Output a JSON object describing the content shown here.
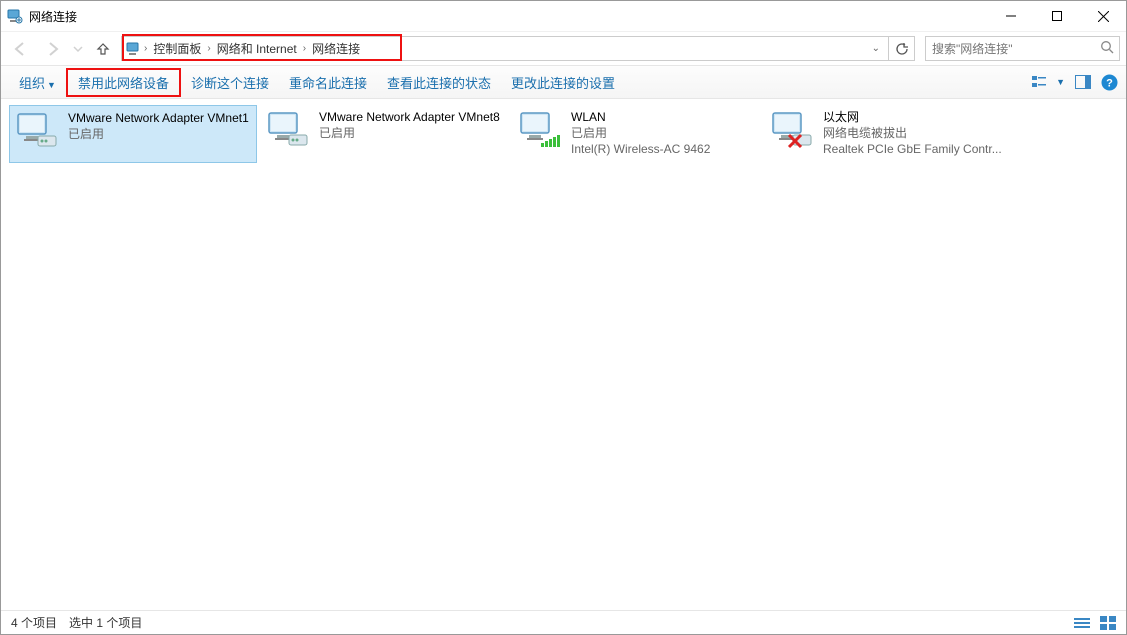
{
  "window": {
    "title": "网络连接"
  },
  "breadcrumb": {
    "items": [
      "控制面板",
      "网络和 Internet",
      "网络连接"
    ]
  },
  "search": {
    "placeholder": "搜索\"网络连接\""
  },
  "toolbar": {
    "organize": "组织",
    "disable": "禁用此网络设备",
    "diagnose": "诊断这个连接",
    "rename": "重命名此连接",
    "viewstatus": "查看此连接的状态",
    "change": "更改此连接的设置"
  },
  "adapters": [
    {
      "name": "VMware Network Adapter VMnet1",
      "status": "已启用",
      "detail": "",
      "kind": "vmware",
      "selected": true
    },
    {
      "name": "VMware Network Adapter VMnet8",
      "status": "已启用",
      "detail": "",
      "kind": "vmware",
      "selected": false
    },
    {
      "name": "WLAN",
      "status": "已启用",
      "detail": "Intel(R) Wireless-AC 9462",
      "kind": "wifi",
      "selected": false
    },
    {
      "name": "以太网",
      "status": "网络电缆被拔出",
      "detail": "Realtek PCIe GbE Family Contr...",
      "kind": "eth-unplugged",
      "selected": false
    }
  ],
  "statusbar": {
    "count": "4 个项目",
    "selected": "选中 1 个项目"
  }
}
